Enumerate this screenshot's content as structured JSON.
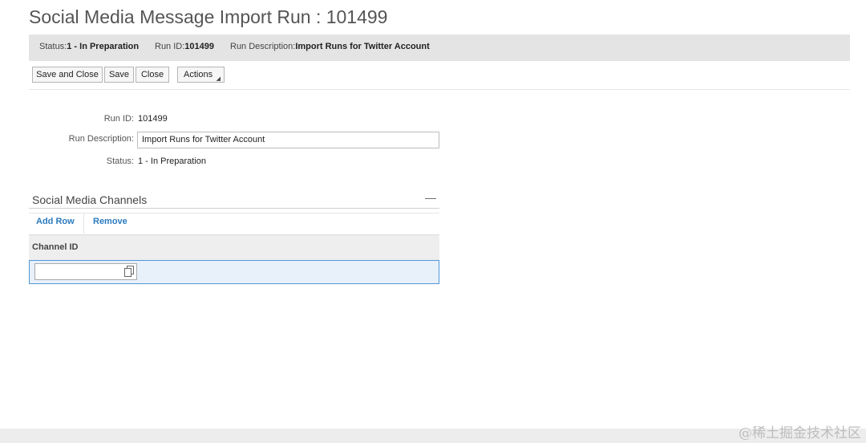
{
  "page": {
    "title": "Social Media Message Import Run : 101499"
  },
  "status_bar": {
    "status_label": "Status:",
    "status_value": "1 - In Preparation",
    "run_id_label": "Run ID:",
    "run_id_value": "101499",
    "run_desc_label": "Run Description:",
    "run_desc_value": "Import Runs for Twitter Account"
  },
  "toolbar": {
    "save_and_close": "Save and Close",
    "save": "Save",
    "close": "Close",
    "actions": "Actions",
    "actions_indicator": "◢"
  },
  "form": {
    "run_id_label": "Run ID:",
    "run_id_value": "101499",
    "run_desc_label": "Run Description:",
    "run_desc_value": "Import Runs for Twitter Account",
    "status_label": "Status:",
    "status_value": "1 - In Preparation"
  },
  "channels": {
    "title": "Social Media Channels",
    "collapse_symbol": "—",
    "add_row": "Add Row",
    "remove": "Remove",
    "column_header": "Channel ID",
    "rows": [
      {
        "channel_id": ""
      }
    ]
  },
  "watermark": "@稀土掘金技术社区",
  "icons": {
    "collapse": "minus-icon",
    "value_help": "value-help-icon"
  }
}
